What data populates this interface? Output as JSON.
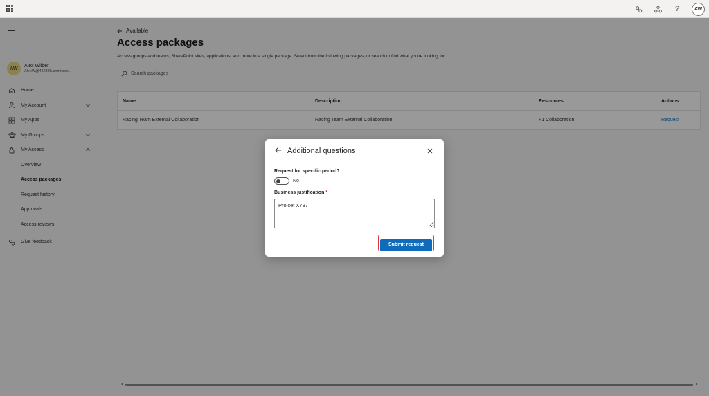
{
  "topbar": {
    "avatar_initials": "AW",
    "help_glyph": "?",
    "icons": [
      "connections-icon",
      "org-icon",
      "help-icon"
    ]
  },
  "sidebar": {
    "user": {
      "initials": "AW",
      "name": "Alex Wilber",
      "email": "AlexW@48238h.onmicros..."
    },
    "items": [
      {
        "label": "Home",
        "icon": "home-icon"
      },
      {
        "label": "My Account",
        "icon": "person-icon",
        "expandable": true
      },
      {
        "label": "My Apps",
        "icon": "apps-icon"
      },
      {
        "label": "My Groups",
        "icon": "groups-icon",
        "expandable": true
      },
      {
        "label": "My Access",
        "icon": "lock-icon",
        "expanded": true
      }
    ],
    "sub_items": [
      {
        "label": "Overview"
      },
      {
        "label": "Access packages",
        "active": true
      },
      {
        "label": "Request history"
      },
      {
        "label": "Approvals"
      },
      {
        "label": "Access reviews"
      }
    ],
    "feedback_label": "Give feedback"
  },
  "main": {
    "back_label": "Available",
    "title": "Access packages",
    "subtitle": "Access groups and teams, SharePoint sites, applications, and more in a single package. Select from the following packages, or search to find what you're looking for.",
    "search_placeholder": "Search packages",
    "table": {
      "columns": [
        "Name",
        "Description",
        "Resources",
        "Actions"
      ],
      "sort_glyph": "↑",
      "rows": [
        {
          "name": "Racing Team External Collaboration",
          "description": "Racing Team External Collaboration",
          "resources": "F1 Collaboration",
          "action": "Request"
        }
      ]
    }
  },
  "dialog": {
    "title": "Additional questions",
    "period_label": "Request for specific period?",
    "period_value": "No",
    "justification_label": "Business justification",
    "required_marker": "*",
    "justification_value": "Projcet X797",
    "submit_label": "Submit request"
  },
  "colors": {
    "accent": "#0f6cbd",
    "highlight_border": "#e0353c",
    "avatar_bg": "#e8d98a"
  }
}
